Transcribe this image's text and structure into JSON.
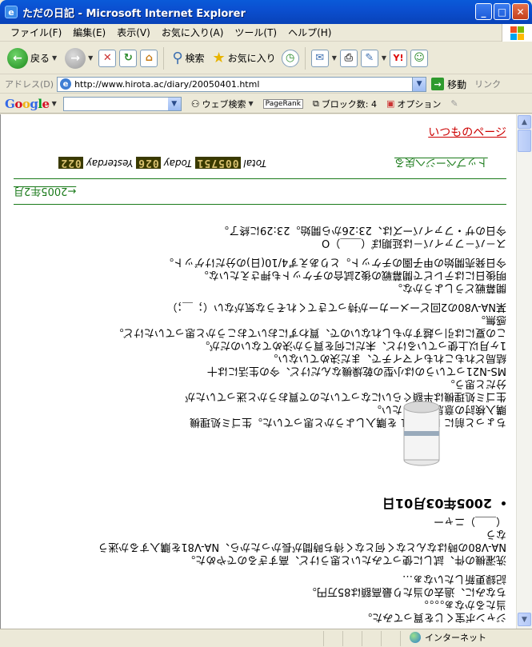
{
  "window": {
    "title": "ただの日記 - Microsoft Internet Explorer",
    "buttons": {
      "minimize": "_",
      "maximize": "□",
      "close": "✕"
    }
  },
  "menu": [
    "ファイル(F)",
    "編集(E)",
    "表示(V)",
    "お気に入り(A)",
    "ツール(T)",
    "ヘルプ(H)"
  ],
  "toolbar": {
    "back": "戻る",
    "search": "検索",
    "favorites": "お気に入り"
  },
  "address": {
    "label": "アドレス(D)",
    "url": "http://www.hirota.ac/diary/20050401.html",
    "go": "移動",
    "links": "リンク"
  },
  "googlebar": {
    "logo": "Google",
    "web_search": "ウェブ検索",
    "pagerank": "PageRank",
    "blocked": "ブロック数: 4",
    "options": "オプション"
  },
  "page": {
    "usual_page_link": "いつものページ",
    "back_to_top": "トップページへ戻る",
    "counter": {
      "yesterday_label": "Yesterday",
      "yesterday": "022",
      "today_label": "Today",
      "today": "026",
      "total_label": "Total",
      "total": "005751"
    },
    "prev_month": "←2005年2月",
    "entry_date": "2005年03月01日",
    "entry_lines": [
      "今日のザ・ファイバーズは、23:26から開始。23:29に終了。",
      "ス－パ－ファイバ－は延期ぽ（＿＿）O",
      "今日発売開始の甲子園のチケット。とりあえず4/10(日)の分だけゲット。",
      "明後日にはテレビで開幕戦の後2試合のチケットも押さえたいな。",
      "開幕戦どうしようかな。",
      "某NA-V80の2回どーメーカーが持ってきてくれそうな気がない（；＿；）",
      "感無。",
      "この夏には引っ越すかもしれないので、買わずにおいておこうかと思っていたけど。",
      "1ヶ月以上使っているけど、未だに何を買うか決めてないのだが。",
      "結局どれもこれもイマイチで、まだ決めていない。",
      "MS-N21っていうのは小型の乾燥機なんだけど、今の生活には十",
      "分だと思う。",
      "生ゴミ処理機は半額ぐらいになっていたので買おうかと迷っていたが",
      "購入検討の意思を示したい。",
      "ちょっと前に MS-N21 を購入しようかと思っていた。生ゴミ処理機"
    ],
    "lower_lines": [
      "（＿＿）ニャー",
      "なう",
      "NA-V80の時はなんとなく何となく待ち時間が長かったから、NA-V81を購入するか迷う",
      "洗濯機の件、試しに使ってみたいと思うけど、高すぎるのでやめた。",
      "記録更新したいなぁ…",
      "ちなみに、過去の当たり最高額は85万円。",
      "当たるかなぁ。。。。",
      "ジャンボ宝くじを買ってみた。"
    ]
  },
  "status": {
    "zone": "インターネット"
  }
}
